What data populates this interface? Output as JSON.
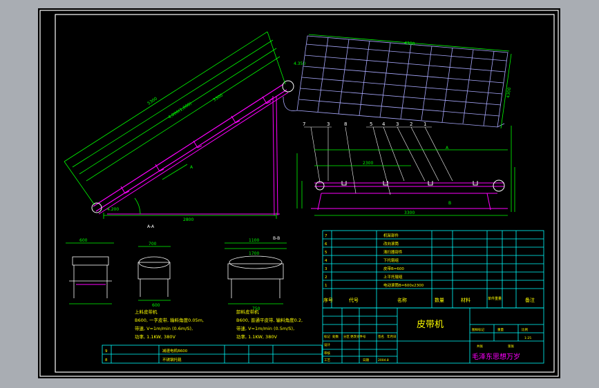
{
  "drawing": {
    "title_cn": "皮带机",
    "designer_cn": "毛泽东思想万岁",
    "scale": "1:25"
  },
  "dimensions": {
    "left_conveyor": [
      "5300",
      "4,000(1,000)",
      "3300",
      "2800",
      "4.350",
      "4.200",
      "A"
    ],
    "upper_conveyor": [
      "4300",
      "4300"
    ],
    "side_view": [
      "2300",
      "3300",
      "A",
      "B",
      "7",
      "3",
      "8",
      "5",
      "4",
      "3",
      "2",
      "1"
    ],
    "sections": [
      "A-A",
      "B-B",
      "600",
      "700",
      "1100",
      "1700",
      "600",
      "750"
    ]
  },
  "bom_rows": [
    {
      "no": "7",
      "name": "机架部件"
    },
    {
      "no": "6",
      "name": "改向滚筒"
    },
    {
      "no": "5",
      "name": "清扫器部件"
    },
    {
      "no": "4",
      "name": "下托辊组"
    },
    {
      "no": "3",
      "name": "皮带B=600"
    },
    {
      "no": "2",
      "name": "上平托辊组"
    },
    {
      "no": "1",
      "name": "电动滚筒B=600x2300"
    }
  ],
  "bom_header": [
    "序号",
    "代号",
    "名称",
    "数量",
    "材料",
    "单件重量",
    "备注"
  ],
  "notes_left": [
    "上料皮带机",
    "B600, 一字皮带, 输料角度0.05m,",
    "带速, V=1m/min (0.6m/S),",
    "功率, 1.1KW, 380V"
  ],
  "notes_right": [
    "卸料皮带机",
    "B600, 普通平皮带, 输料角度0.2,",
    "带速, V=1m/min (0.5m/S),",
    "功率, 1.1KW, 380V"
  ],
  "lower_bom": [
    {
      "no": "9",
      "name": "减速电机B600"
    },
    {
      "no": "8",
      "name": "不锈钢托辊"
    }
  ],
  "title_block": {
    "labels": [
      "标记",
      "处数",
      "分区",
      "更改文件号",
      "签名",
      "年月日",
      "设计",
      "审核",
      "工艺",
      "日期"
    ],
    "right_labels": [
      "图样标记",
      "重量",
      "比例",
      "共张",
      "第张"
    ],
    "date": "2004.8"
  },
  "colors": {
    "background": "#000000",
    "frame": "#ffffff",
    "dims": "#00ff00",
    "structure": "#ff00ff",
    "table": "#00ffff",
    "text": "#ffff00",
    "hidden": "#aaaaff"
  }
}
